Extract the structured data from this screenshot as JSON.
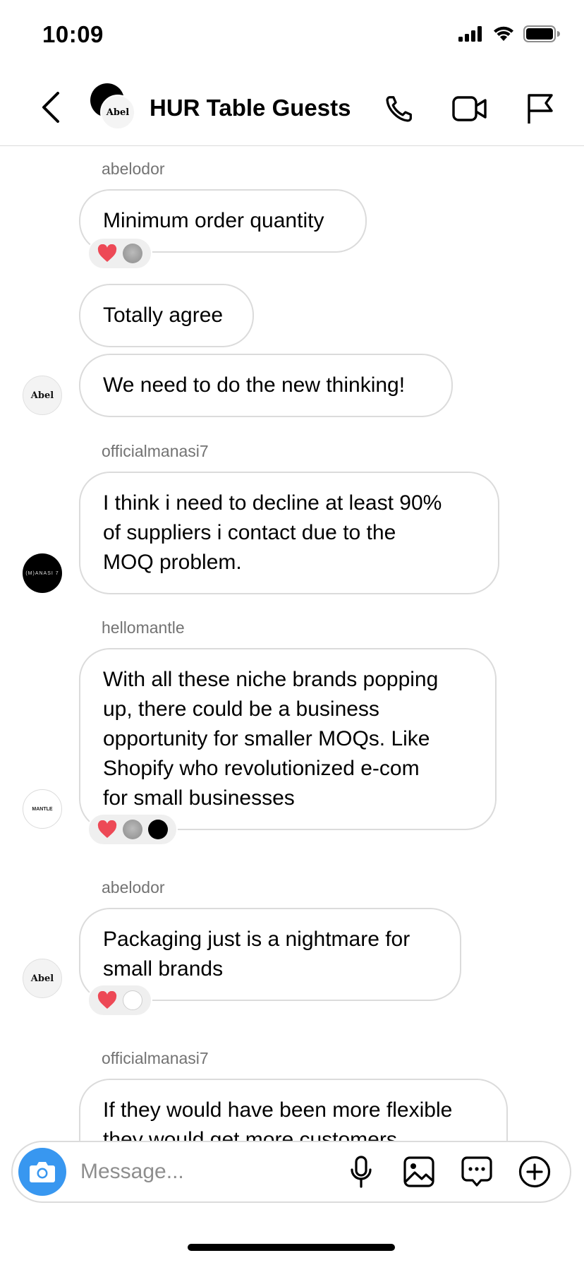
{
  "status_bar": {
    "time": "10:09"
  },
  "header": {
    "title": "HUR Table Guests",
    "avatar_label": "Abel"
  },
  "messages": [
    {
      "sender": "abelodor",
      "text": "Minimum order quantity",
      "reactions": [
        "heart",
        "grey"
      ]
    },
    {
      "text": "Totally agree"
    },
    {
      "text": "We need to do the new thinking!",
      "avatar_label": "Abel"
    },
    {
      "sender": "officialmanasi7",
      "lines": [
        "I think i need to decline at least 90%",
        "of suppliers i contact due to the",
        "MOQ problem."
      ],
      "avatar_label": "(M)ANASI 7"
    },
    {
      "sender": "hellomantle",
      "lines": [
        "With all these niche brands popping",
        "up, there could be a business",
        "opportunity for smaller MOQs. Like",
        "Shopify who revolutionized e-com",
        "for small businesses"
      ],
      "avatar_label": "MANTLE",
      "reactions": [
        "heart",
        "grey",
        "black"
      ]
    },
    {
      "sender": "abelodor",
      "lines": [
        "Packaging just is a nightmare for",
        "small brands"
      ],
      "avatar_label": "Abel",
      "reactions": [
        "heart",
        "white"
      ]
    },
    {
      "sender": "officialmanasi7",
      "lines": [
        "If they would have been more flexible",
        "they would get more customers"
      ]
    }
  ],
  "composer": {
    "placeholder": "Message..."
  },
  "colors": {
    "accent": "#3897f0",
    "bubble_border": "#dbdbdb",
    "meta_text": "#737373",
    "heart": "#ed4956"
  }
}
